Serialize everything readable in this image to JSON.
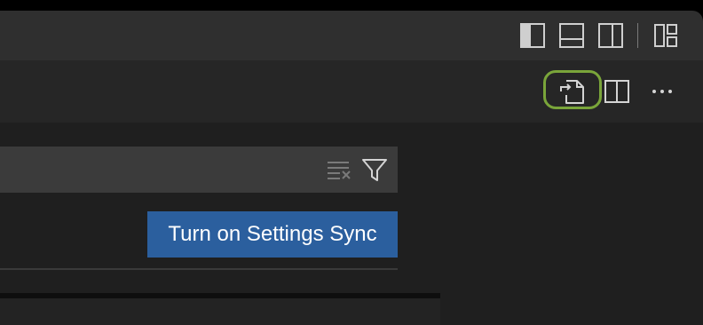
{
  "titlebar": {
    "icons": [
      "toggle-primary-sidebar-icon",
      "toggle-panel-icon",
      "toggle-secondary-sidebar-icon",
      "customize-layout-icon"
    ]
  },
  "editor_toolbar": {
    "icons": [
      "open-settings-json-icon",
      "split-editor-icon",
      "more-actions-icon"
    ],
    "highlight_color": "#7aa53a"
  },
  "settings": {
    "search_placeholder": "",
    "sync_button_label": "Turn on Settings Sync",
    "sync_button_color": "#2b5f9e"
  }
}
